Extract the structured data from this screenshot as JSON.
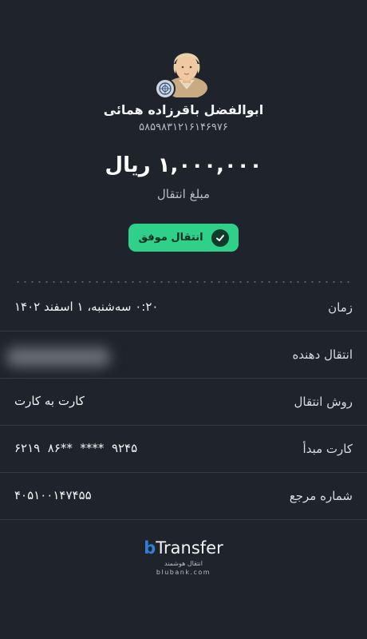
{
  "recipient": {
    "name": "ابوالفضل باقرزاده همائی",
    "card_number": "۵۸۵۹۸۳۱۲۱۶۱۴۶۹۷۶"
  },
  "transfer": {
    "amount": "۱,۰۰۰,۰۰۰ ریال",
    "amount_label": "مبلغ انتقال",
    "status": "انتقال موفق"
  },
  "details": {
    "time": {
      "label": "زمان",
      "value": "۰:۲۰ سه‌شنبه، ۱ اسفند ۱۴۰۲"
    },
    "sender": {
      "label": "انتقال دهنده",
      "value": ""
    },
    "method": {
      "label": "روش انتقال",
      "value": "کارت به کارت"
    },
    "source_card": {
      "label": "کارت مبدأ",
      "value": "۶۲۱۹  ۸۶**  ****  ۹۲۴۵"
    },
    "reference": {
      "label": "شماره مرجع",
      "value": "۴۰۵۱۰۰۱۴۷۴۵۵"
    }
  },
  "brand": {
    "b": "b",
    "name": "Transfer",
    "subtitle": "انتقال هوشمند",
    "domain": "blubank.com"
  },
  "colors": {
    "background": "#1f232b",
    "success": "#2fd08a",
    "brand_blue": "#2f7ed8"
  },
  "icons": {
    "avatar": "person-avatar-icon",
    "bank_logo": "bank-logo-icon",
    "status": "checkmark-icon"
  }
}
